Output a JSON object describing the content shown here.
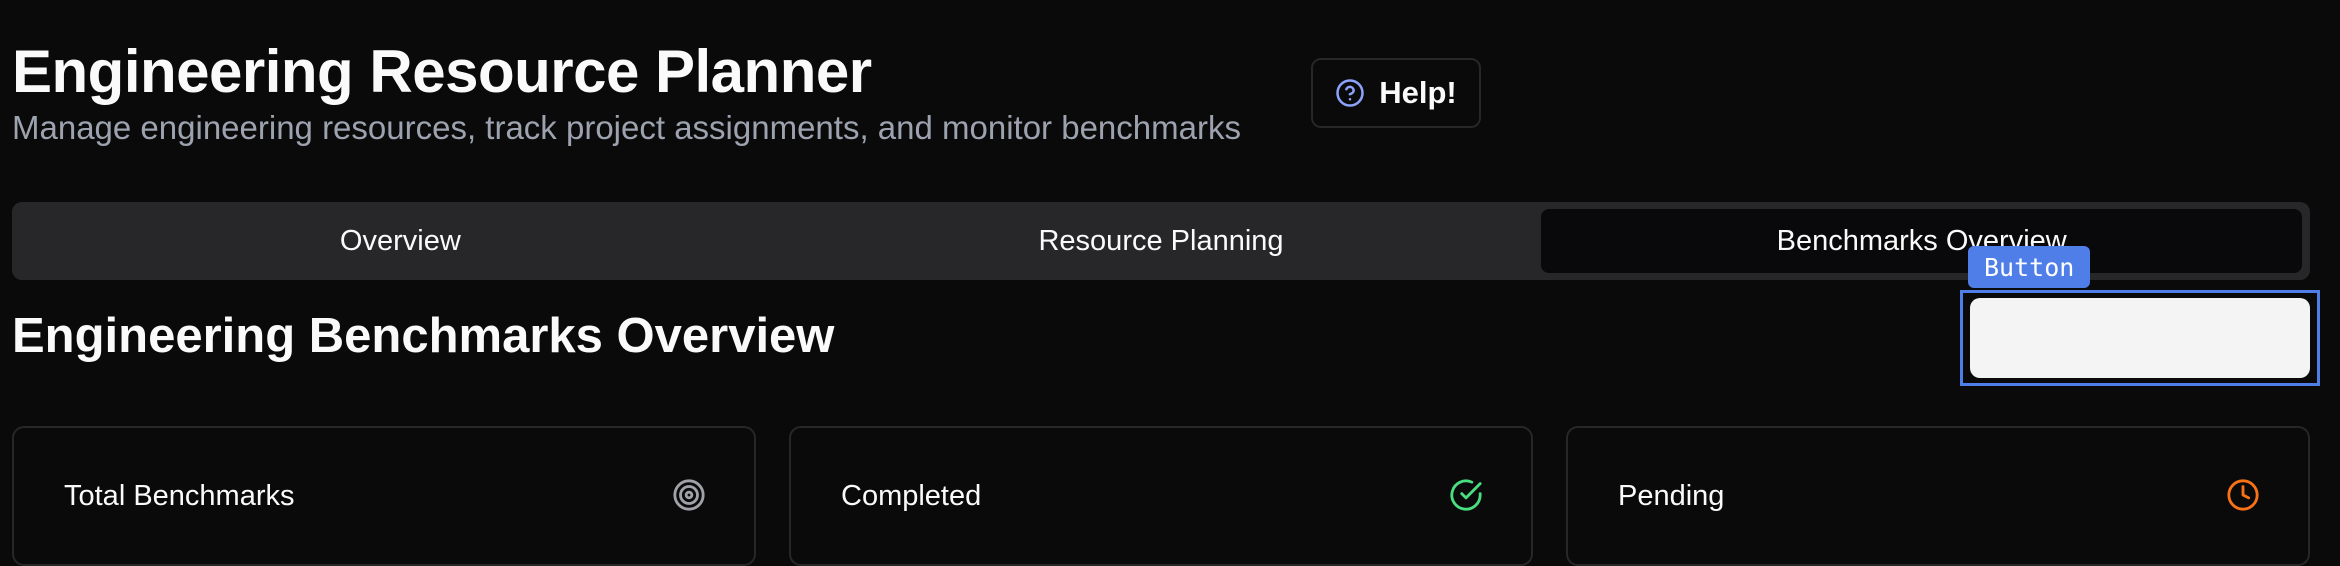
{
  "app": {
    "title": "Engineering Resource Planner",
    "subtitle": "Manage engineering resources, track project assignments, and monitor benchmarks",
    "help_label": "Help!",
    "help_icon": "question-circle-icon"
  },
  "tabs": [
    {
      "label": "Overview",
      "active": false
    },
    {
      "label": "Resource Planning",
      "active": false
    },
    {
      "label": "Benchmarks Overview",
      "active": true
    }
  ],
  "section": {
    "title": "Engineering Benchmarks Overview",
    "action_button_label": "",
    "tooltip": "Button"
  },
  "cards": [
    {
      "label": "Total Benchmarks",
      "icon": "target-icon",
      "icon_color": "#a1a1aa"
    },
    {
      "label": "Completed",
      "icon": "check-circle-icon",
      "icon_color": "#4ade80"
    },
    {
      "label": "Pending",
      "icon": "clock-icon",
      "icon_color": "#f97316"
    }
  ],
  "colors": {
    "background": "#0a0a0b",
    "tab_bar": "#27272a",
    "highlight": "#4f7ee8"
  }
}
